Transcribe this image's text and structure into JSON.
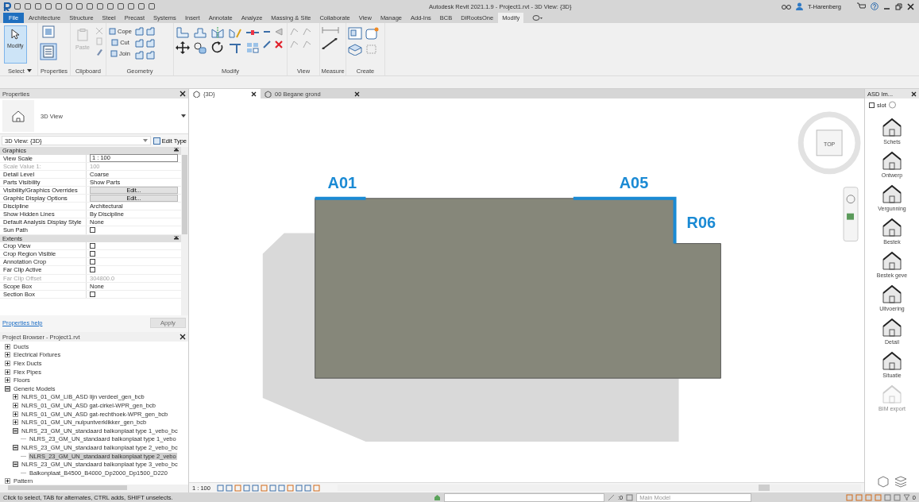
{
  "title_bar": {
    "title": "Autodesk Revit 2021.1.9 - Project1.rvt - 3D View: {3D}",
    "user": "T-Harenberg"
  },
  "ribbon": {
    "tabs": [
      {
        "label": "File",
        "kind": "file",
        "selected": false
      },
      {
        "label": "Architecture",
        "kind": "tab",
        "selected": false
      },
      {
        "label": "Structure",
        "kind": "tab",
        "selected": false
      },
      {
        "label": "Steel",
        "kind": "tab",
        "selected": false
      },
      {
        "label": "Precast",
        "kind": "tab",
        "selected": false
      },
      {
        "label": "Systems",
        "kind": "tab",
        "selected": false
      },
      {
        "label": "Insert",
        "kind": "tab",
        "selected": false
      },
      {
        "label": "Annotate",
        "kind": "tab",
        "selected": false
      },
      {
        "label": "Analyze",
        "kind": "tab",
        "selected": false
      },
      {
        "label": "Massing & Site",
        "kind": "tab",
        "selected": false
      },
      {
        "label": "Collaborate",
        "kind": "tab",
        "selected": false
      },
      {
        "label": "View",
        "kind": "tab",
        "selected": false
      },
      {
        "label": "Manage",
        "kind": "tab",
        "selected": false
      },
      {
        "label": "Add-Ins",
        "kind": "tab",
        "selected": false
      },
      {
        "label": "BCB",
        "kind": "tab",
        "selected": false
      },
      {
        "label": "DiRootsOne",
        "kind": "tab",
        "selected": false
      },
      {
        "label": "Modify",
        "kind": "tab",
        "selected": true
      }
    ],
    "groups": [
      {
        "label": "Select",
        "dropdown": true,
        "tools": [
          {
            "label": "Modify",
            "selected": true,
            "disabled": false
          }
        ]
      },
      {
        "label": "Properties"
      },
      {
        "label": "Clipboard",
        "tools": [
          {
            "label": "Paste",
            "selected": false,
            "disabled": true
          }
        ]
      },
      {
        "label": "Geometry",
        "tools": [
          {
            "label": "Cope",
            "disabled": false
          },
          {
            "label": "Cut",
            "disabled": false
          },
          {
            "label": "Join",
            "disabled": false
          }
        ]
      },
      {
        "label": "Modify"
      },
      {
        "label": "View"
      },
      {
        "label": "Measure"
      },
      {
        "label": "Create"
      }
    ]
  },
  "properties": {
    "title": "Properties",
    "type_name": "3D View",
    "instance": "3D View: {3D}",
    "edit_type": "Edit Type",
    "sections": [
      {
        "name": "Graphics",
        "rows": [
          {
            "name": "View Scale",
            "value": "1 : 100",
            "kind": "input",
            "disabled": false
          },
          {
            "name": "Scale Value    1:",
            "value": "100",
            "kind": "text",
            "disabled": true
          },
          {
            "name": "Detail Level",
            "value": "Coarse",
            "kind": "text",
            "disabled": false
          },
          {
            "name": "Parts Visibility",
            "value": "Show Parts",
            "kind": "text",
            "disabled": false
          },
          {
            "name": "Visibility/Graphics Overrides",
            "value": "Edit...",
            "kind": "button",
            "disabled": false
          },
          {
            "name": "Graphic Display Options",
            "value": "Edit...",
            "kind": "button",
            "disabled": false
          },
          {
            "name": "Discipline",
            "value": "Architectural",
            "kind": "text",
            "disabled": false
          },
          {
            "name": "Show Hidden Lines",
            "value": "By Discipline",
            "kind": "text",
            "disabled": false
          },
          {
            "name": "Default Analysis Display Style",
            "value": "None",
            "kind": "text",
            "disabled": false
          },
          {
            "name": "Sun Path",
            "kind": "checkbox",
            "checked": false,
            "disabled": false
          }
        ]
      },
      {
        "name": "Extents",
        "rows": [
          {
            "name": "Crop View",
            "kind": "checkbox",
            "checked": false,
            "disabled": false
          },
          {
            "name": "Crop Region Visible",
            "kind": "checkbox",
            "checked": false,
            "disabled": false
          },
          {
            "name": "Annotation Crop",
            "kind": "checkbox",
            "checked": false,
            "disabled": false
          },
          {
            "name": "Far Clip Active",
            "kind": "checkbox",
            "checked": false,
            "disabled": false
          },
          {
            "name": "Far Clip Offset",
            "value": "304800.0",
            "kind": "text",
            "disabled": true
          },
          {
            "name": "Scope Box",
            "value": "None",
            "kind": "text",
            "disabled": false
          },
          {
            "name": "Section Box",
            "kind": "checkbox",
            "checked": false,
            "disabled": false
          }
        ]
      }
    ],
    "help_link": "Properties help",
    "apply": {
      "label": "Apply",
      "disabled": true
    }
  },
  "project_browser": {
    "title": "Project Browser - Project1.rvt",
    "items": [
      {
        "label": "Ducts",
        "expanded": false,
        "selected": false
      },
      {
        "label": "Electrical Fixtures",
        "expanded": false,
        "selected": false
      },
      {
        "label": "Flex Ducts",
        "expanded": false,
        "selected": false
      },
      {
        "label": "Flex Pipes",
        "expanded": false,
        "selected": false
      },
      {
        "label": "Floors",
        "expanded": false,
        "selected": false
      },
      {
        "label": "Generic Models",
        "expanded": true,
        "selected": false,
        "children": [
          {
            "label": "NLRS_01_GM_LIB_ASD lijn verdeel_gen_bcb",
            "expanded": false,
            "selected": false
          },
          {
            "label": "NLRS_01_GM_UN_ASD gat-cirkel-WPR_gen_bcb",
            "expanded": false,
            "selected": false
          },
          {
            "label": "NLRS_01_GM_UN_ASD gat-rechthoek-WPR_gen_bcb",
            "expanded": false,
            "selected": false
          },
          {
            "label": "NLRS_01_GM_UN_nulpuntverklikker_gen_bcb",
            "expanded": false,
            "selected": false
          },
          {
            "label": "NLRS_23_GM_UN_standaard balkonplaat type 1_vebo_bc",
            "expanded": true,
            "selected": false,
            "children": [
              {
                "label": "NLRS_23_GM_UN_standaard balkonplaat type 1_vebo",
                "selected": false
              }
            ]
          },
          {
            "label": "NLRS_23_GM_UN_standaard balkonplaat type 2_vebo_bc",
            "expanded": true,
            "selected": false,
            "children": [
              {
                "label": "NLRS_23_GM_UN_standaard balkonplaat type 2_vebo",
                "selected": true
              }
            ]
          },
          {
            "label": "NLRS_23_GM_UN_standaard balkonplaat type 3_vebo_bc",
            "expanded": true,
            "selected": false,
            "children": [
              {
                "label": "Balkonplaat_B4500_B4000_Dp2000_Dp1500_D220",
                "selected": false
              }
            ]
          }
        ]
      },
      {
        "label": "Pattern",
        "expanded": false,
        "selected": false
      }
    ]
  },
  "view_tabs": [
    {
      "label": "{3D}",
      "selected": true
    },
    {
      "label": "00 Begane grond",
      "selected": false
    }
  ],
  "canvas": {
    "tags": [
      "A01",
      "A05",
      "R06"
    ],
    "viewcube_face": "TOP"
  },
  "view_control": {
    "scale": "1 : 100"
  },
  "side_panel": {
    "title": "ASD Im...",
    "lock": {
      "label": "slot",
      "checked": false
    },
    "items": [
      {
        "label": "Schets",
        "disabled": false
      },
      {
        "label": "Ontwerp",
        "disabled": false
      },
      {
        "label": "Vergunning",
        "disabled": false
      },
      {
        "label": "Bestek",
        "disabled": false
      },
      {
        "label": "Bestek geve",
        "disabled": false
      },
      {
        "label": "Uitvoering",
        "disabled": false
      },
      {
        "label": "Detail",
        "disabled": false
      },
      {
        "label": "Situatie",
        "disabled": false
      },
      {
        "label": "BIM export",
        "disabled": true
      }
    ]
  },
  "status_bar": {
    "message": "Click to select, TAB for alternates, CTRL adds, SHIFT unselects.",
    "selection_count": ":0",
    "workset": "Main Model",
    "filter_count": "0"
  }
}
